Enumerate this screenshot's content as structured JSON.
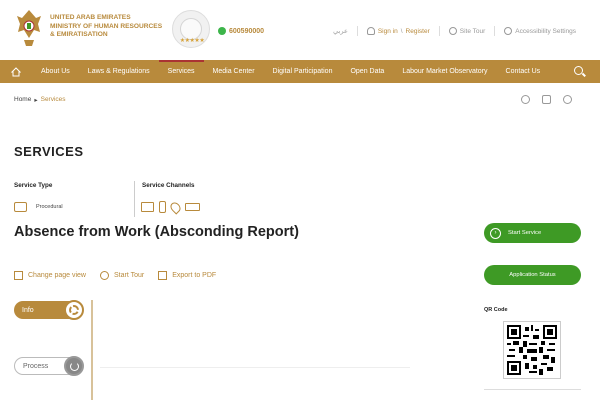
{
  "header": {
    "ministry_line1": "UNITED ARAB EMIRATES",
    "ministry_line2": "MINISTRY OF HUMAN RESOURCES",
    "ministry_line3": "& EMIRATISATION",
    "phone": "600590000",
    "arabic_link": "عربي",
    "sign_in": "Sign in",
    "separator": "\\",
    "register": "Register",
    "site_tour": "Site Tour",
    "accessibility": "Accessibility Settings",
    "stars": "★★★★★"
  },
  "nav": {
    "items": [
      "About Us",
      "Laws & Regulations",
      "Services",
      "Media Center",
      "Digital Participation",
      "Open Data",
      "Labour Market Observatory",
      "Contact Us"
    ],
    "active": "Services"
  },
  "breadcrumb": {
    "home": "Home",
    "arrow": "▸",
    "current": "Services"
  },
  "page": {
    "title": "SERVICES",
    "service_type_label": "Service Type",
    "service_type_value": "Procedural",
    "service_channels_label": "Service Channels",
    "service_title": "Absence from Work (Absconding Report)"
  },
  "actions": {
    "change_view": "Change page view",
    "start_tour": "Start Tour",
    "export_pdf": "Export to PDF"
  },
  "sidebar": {
    "start_service": "Start Service",
    "start_icon": "›",
    "application_status": "Application Status",
    "qr_label": "QR Code"
  },
  "timeline": {
    "info": "Info",
    "process": "Process"
  },
  "colors": {
    "brand_gold": "#b88a3c",
    "green": "#3e9a25"
  }
}
